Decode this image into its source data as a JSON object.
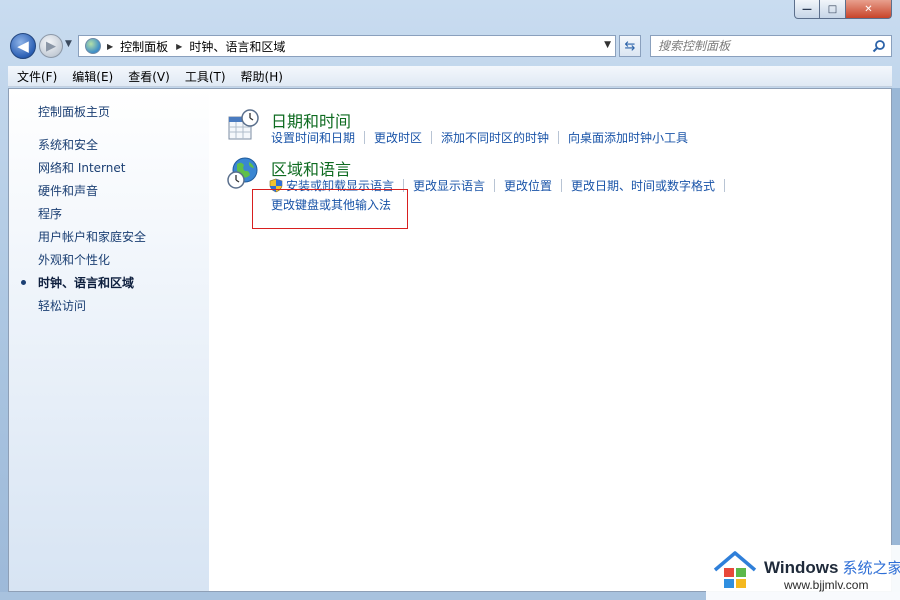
{
  "window": {
    "minimize_label": "—",
    "maximize_label": "□",
    "close_label": "✕"
  },
  "nav": {
    "back_icon": "back-arrow-icon",
    "forward_icon": "forward-arrow-icon",
    "breadcrumb": [
      "控制面板",
      "时钟、语言和区域"
    ],
    "search_placeholder": "搜索控制面板"
  },
  "menu": [
    {
      "label": "文件(F)"
    },
    {
      "label": "编辑(E)"
    },
    {
      "label": "查看(V)"
    },
    {
      "label": "工具(T)"
    },
    {
      "label": "帮助(H)"
    }
  ],
  "sidebar": {
    "items": [
      {
        "label": "控制面板主页",
        "current": false
      },
      {
        "label": "系统和安全",
        "current": false
      },
      {
        "label": "网络和 Internet",
        "current": false
      },
      {
        "label": "硬件和声音",
        "current": false
      },
      {
        "label": "程序",
        "current": false
      },
      {
        "label": "用户帐户和家庭安全",
        "current": false
      },
      {
        "label": "外观和个性化",
        "current": false
      },
      {
        "label": "时钟、语言和区域",
        "current": true
      },
      {
        "label": "轻松访问",
        "current": false
      }
    ]
  },
  "categories": [
    {
      "title": "日期和时间",
      "icon": "calendar-clock-icon",
      "tasks": [
        "设置时间和日期",
        "更改时区",
        "添加不同时区的时钟",
        "向桌面添加时钟小工具"
      ]
    },
    {
      "title": "区域和语言",
      "icon": "globe-clock-icon",
      "tasks": [
        "安装或卸载显示语言",
        "更改显示语言",
        "更改位置",
        "更改日期、时间或数字格式",
        "更改键盘或其他输入法"
      ]
    }
  ],
  "watermark": {
    "brand": "Windows",
    "brand_cn": "系统之家",
    "url": "www.bjjmlv.com"
  },
  "colors": {
    "link": "#1a54a8",
    "category_title": "#0e6b20",
    "highlight": "#d81f1f"
  }
}
